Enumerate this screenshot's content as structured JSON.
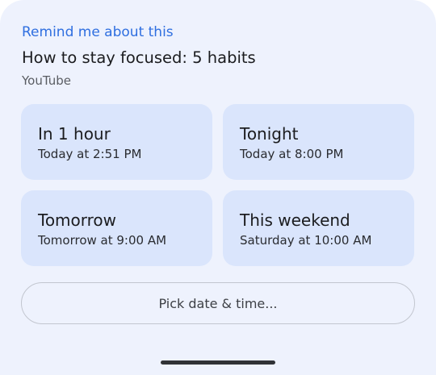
{
  "sheet": {
    "heading": "Remind me about this",
    "title": "How to stay focused: 5 habits",
    "source": "YouTube"
  },
  "options": [
    {
      "label": "In 1 hour",
      "time": "Today at 2:51 PM"
    },
    {
      "label": "Tonight",
      "time": "Today at 8:00 PM"
    },
    {
      "label": "Tomorrow",
      "time": "Tomorrow at 9:00 AM"
    },
    {
      "label": "This weekend",
      "time": "Saturday at 10:00 AM"
    }
  ],
  "actions": {
    "pick_label": "Pick date & time..."
  },
  "colors": {
    "accent": "#2f6fe0",
    "sheet_background": "#eef2fd",
    "option_background": "#dae5fc"
  }
}
